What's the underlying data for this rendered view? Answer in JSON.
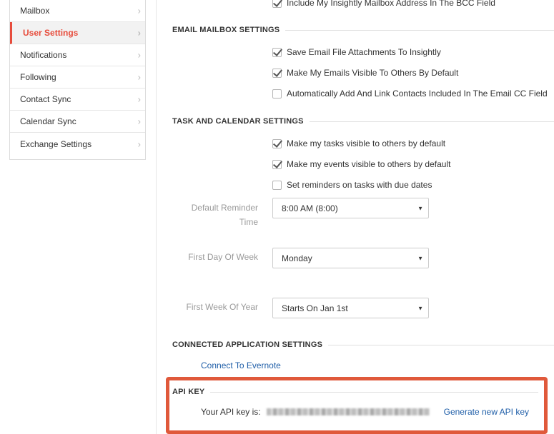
{
  "sidebar": {
    "items": [
      {
        "label": "Mailbox"
      },
      {
        "label": "User Settings"
      },
      {
        "label": "Notifications"
      },
      {
        "label": "Following"
      },
      {
        "label": "Contact Sync"
      },
      {
        "label": "Calendar Sync"
      },
      {
        "label": "Exchange Settings"
      }
    ],
    "chevron": "›",
    "active_index": 1
  },
  "top_partial": {
    "label": "Include My Insightly Mailbox Address In The BCC Field",
    "checked": true
  },
  "email_section": {
    "title": "EMAIL MAILBOX SETTINGS",
    "options": [
      {
        "label": "Save Email File Attachments To Insightly",
        "checked": true
      },
      {
        "label": "Make My Emails Visible To Others By Default",
        "checked": true
      },
      {
        "label": "Automatically Add And Link Contacts Included In The Email CC Field",
        "checked": false
      }
    ]
  },
  "task_section": {
    "title": "TASK AND CALENDAR SETTINGS",
    "options": [
      {
        "label": "Make my tasks visible to others by default",
        "checked": true
      },
      {
        "label": "Make my events visible to others by default",
        "checked": true
      },
      {
        "label": "Set reminders on tasks with due dates",
        "checked": false
      }
    ],
    "fields": {
      "reminder": {
        "label_line1": "Default Reminder",
        "label_line2": "Time",
        "value": "8:00 AM (8:00)"
      },
      "first_day": {
        "label": "First Day Of Week",
        "value": "Monday"
      },
      "first_week": {
        "label": "First Week Of Year",
        "value": "Starts On Jan 1st"
      }
    },
    "dropdown_arrow": "▼"
  },
  "connected_section": {
    "title": "CONNECTED APPLICATION SETTINGS",
    "evernote_link": "Connect To Evernote"
  },
  "api_section": {
    "title": "API KEY",
    "key_label": "Your API key is:",
    "generate_link": "Generate new API key",
    "highlight_color": "#e0593b"
  },
  "colors": {
    "accent": "#e74c3c",
    "link": "#1f5ea8"
  }
}
